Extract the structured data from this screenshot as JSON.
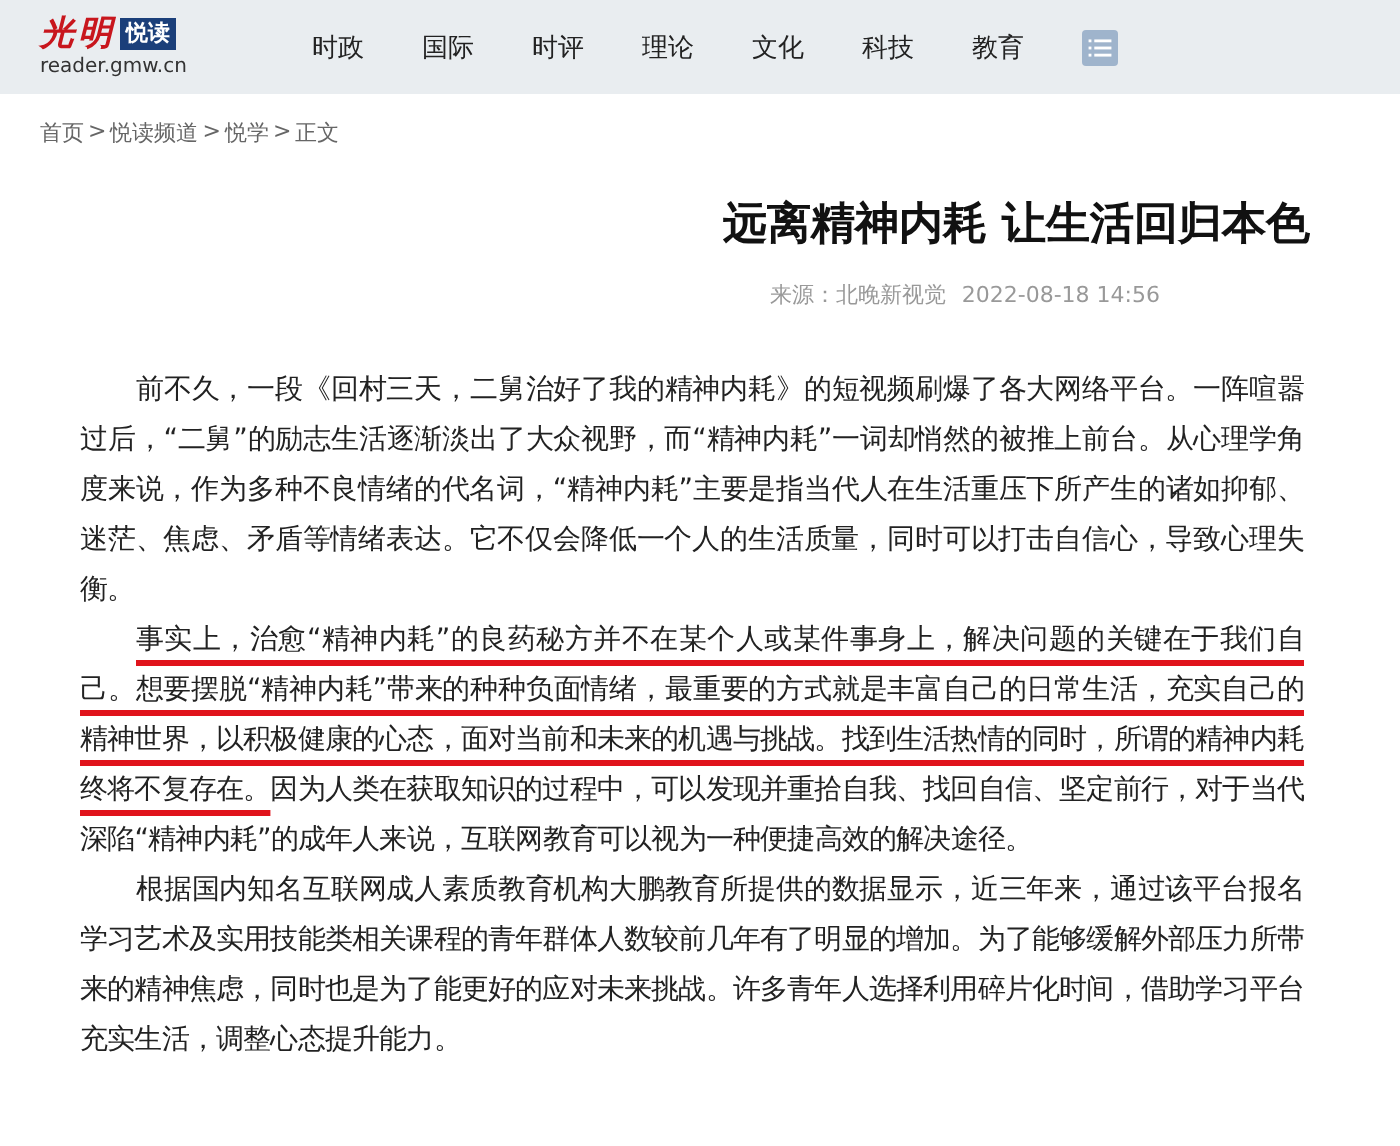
{
  "header": {
    "logo": {
      "brand": "光明",
      "channel": "悦读",
      "domain": "reader.gmw.cn"
    },
    "nav": [
      "时政",
      "国际",
      "时评",
      "理论",
      "文化",
      "科技",
      "教育"
    ]
  },
  "breadcrumb": [
    {
      "label": "首页",
      "separator": ">"
    },
    {
      "label": "悦读频道",
      "separator": ">"
    },
    {
      "label": "悦学",
      "separator": " >"
    },
    {
      "label": "正文"
    }
  ],
  "article": {
    "title": "远离精神内耗 让生活回归本色",
    "source": "来源：北晚新视觉",
    "date": "2022-08-18 14:56",
    "paragraphs": [
      [
        {
          "text": "前不久，一段《回村三天，二舅治好了我的精神内耗》的短视频刷爆了各大网络平台。一阵喧嚣过后，“二舅”的励志生活逐渐淡出了大众视野，而“精神内耗”一词却悄然的被推上前台。从心理学角度来说，作为多种不良情绪的代名词，“精神内耗”主要是指当代人在生活重压下所产生的诸如抑郁、迷茫、焦虑、矛盾等情绪表达。它不仅会降低一个人的生活质量，同时可以打击自信心，导致心理失衡。",
          "underlined": false
        }
      ],
      [
        {
          "text": "事实上，治愈“精神内耗”的良药秘方并不在某个人或某件事身上，解决问题的关键在于我们自己。想要摆脱“精神内耗”带来的种种负面情绪，最重要的方式就是丰富自己的日常生活，充实自己的精神世界，以积极健康的心态，面对当前和未来的机遇与挑战。找到生活热情的同时，所谓的精神内耗终将不复存在。",
          "underlined": true
        },
        {
          "text": "因为人类在获取知识的过程中，可以发现并重拾自我、找回自信、坚定前行，对于当代深陷“精神内耗”的成年人来说，互联网教育可以视为一种便捷高效的解决途径。",
          "underlined": false
        }
      ],
      [
        {
          "text": "根据国内知名互联网成人素质教育机构大鹏教育所提供的数据显示，近三年来，通过该平台报名学习艺术及实用技能类相关课程的青年群体人数较前几年有了明显的增加。为了能够缓解外部压力所带来的精神焦虑，同时也是为了能更好的应对未来挑战。许多青年人选择利用碎片化时间，借助学习平台充实生活，调整心态提升能力。",
          "underlined": false
        }
      ]
    ]
  }
}
